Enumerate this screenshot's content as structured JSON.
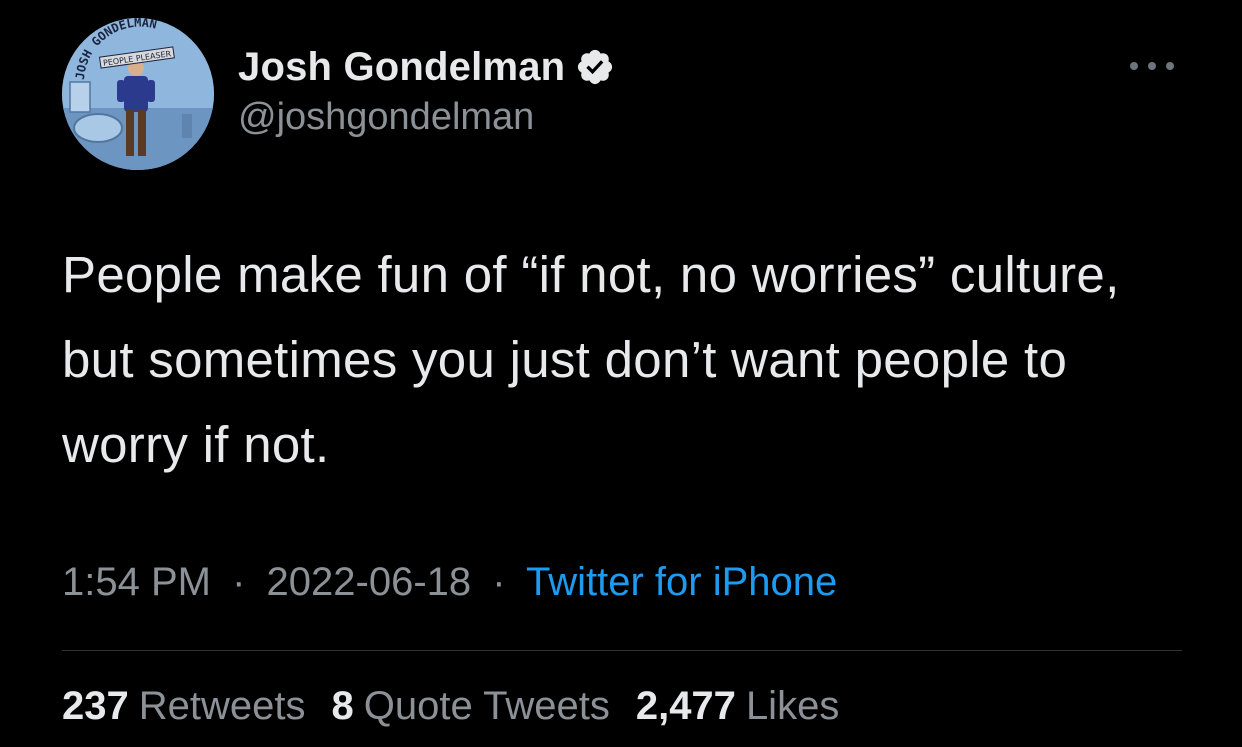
{
  "author": {
    "display_name": "Josh Gondelman",
    "handle": "@joshgondelman",
    "verified": true,
    "avatar_banner_text": "JOSH GONDELMAN",
    "avatar_subtitle_text": "PEOPLE PLEASER"
  },
  "tweet": {
    "text": "People make fun of “if not, no worries” culture, but sometimes you just don’t want people to worry if not."
  },
  "meta": {
    "time": "1:54 PM",
    "separator": "·",
    "date": "2022-06-18",
    "source": "Twitter for iPhone"
  },
  "stats": {
    "retweets_count": "237",
    "retweets_label": "Retweets",
    "quotes_count": "8",
    "quotes_label": "Quote Tweets",
    "likes_count": "2,477",
    "likes_label": "Likes"
  },
  "icons": {
    "verified": "verified-badge-icon",
    "more": "more-horizontal-icon"
  },
  "colors": {
    "background": "#000000",
    "primary_text": "#e7e9ea",
    "secondary_text": "#8b9196",
    "link": "#1d9bf0",
    "divider": "#2f3336"
  }
}
